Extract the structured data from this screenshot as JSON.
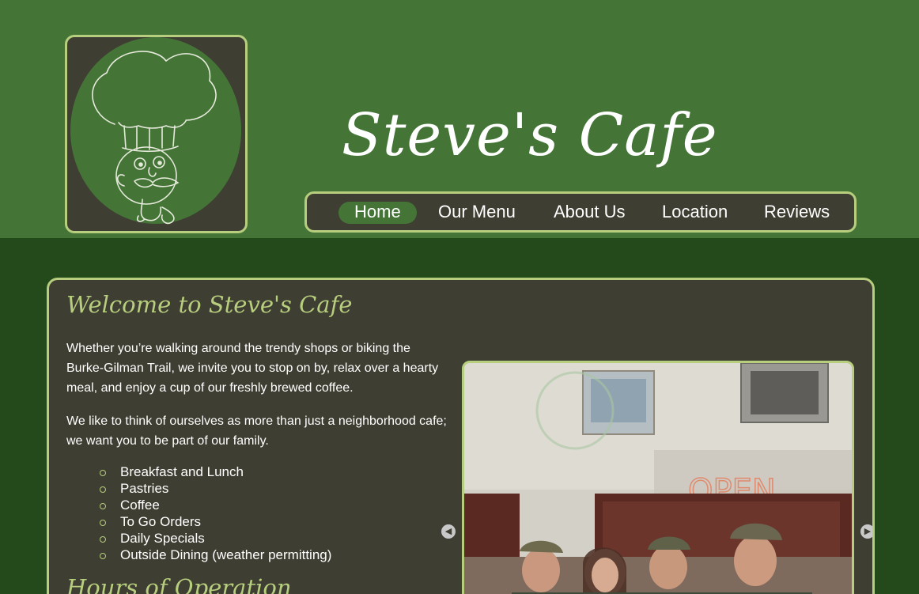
{
  "header": {
    "site_title": "Steve's Cafe",
    "logo_icon": "chef-mascot-icon"
  },
  "nav": {
    "items": [
      {
        "label": "Home",
        "active": true
      },
      {
        "label": "Our Menu",
        "active": false
      },
      {
        "label": "About Us",
        "active": false
      },
      {
        "label": "Location",
        "active": false
      },
      {
        "label": "Reviews",
        "active": false
      }
    ]
  },
  "main": {
    "heading": "Welcome to Steve's Cafe",
    "paragraph1": "Whether you’re walking around the trendy shops or biking the Burke-Gilman Trail, we invite you to stop on by, relax over a hearty meal, and enjoy a cup of our freshly brewed coffee.",
    "paragraph2": "We like to think of ourselves as more than just a neighborhood cafe; we want you to be part of our family.",
    "features": [
      "Breakfast and Lunch",
      "Pastries",
      "Coffee",
      "To Go Orders",
      "Daily Specials",
      "Outside Dining (weather permitting)"
    ],
    "hours_heading": "Hours of Operation"
  },
  "slideshow": {
    "sign_text": "OPEN",
    "prev_icon": "chevron-left-icon",
    "next_icon": "chevron-right-icon"
  },
  "colors": {
    "header_green": "#447537",
    "page_green": "#244a1c",
    "panel": "#3f3e32",
    "accent": "#b7ce7e"
  }
}
